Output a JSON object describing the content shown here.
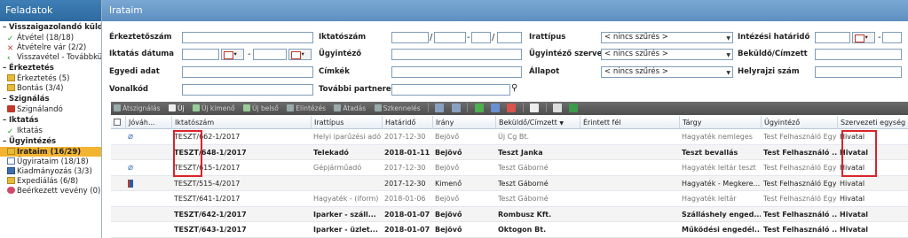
{
  "sidebar": {
    "title": "Feladatok",
    "sections": [
      {
        "label": "Visszaigazolandó küldemé",
        "items": [
          {
            "icon": "check-arrow-icon",
            "label": "Átvétel (18/18)"
          },
          {
            "icon": "cross-arrow-icon",
            "label": "Átvételre vár (2/2)"
          },
          {
            "icon": "reverse-arrow-icon",
            "label": "Visszavétel - Továbbküldé"
          }
        ]
      },
      {
        "label": "Érkeztetés",
        "items": [
          {
            "icon": "folder-icon",
            "label": "Érkeztetés (5)"
          },
          {
            "icon": "folder-icon",
            "label": "Bontás (3/4)"
          }
        ]
      },
      {
        "label": "Szignálás",
        "items": [
          {
            "icon": "stamp-icon",
            "label": "Szignálandó"
          }
        ]
      },
      {
        "label": "Iktatás",
        "items": [
          {
            "icon": "check-icon",
            "label": "Iktatás"
          }
        ]
      },
      {
        "label": "Ügyintézés",
        "items": [
          {
            "icon": "folder-icon",
            "label": "Irataim (16/29)",
            "active": true
          },
          {
            "icon": "document-icon",
            "label": "Ügyirataim (18/18)"
          },
          {
            "icon": "send-icon",
            "label": "Kiadmányozás (3/3)"
          },
          {
            "icon": "folder-icon",
            "label": "Expediálás (6/8)"
          },
          {
            "icon": "inbox-icon",
            "label": "Beérkezett vevény (0)"
          }
        ]
      }
    ]
  },
  "main": {
    "title": "Irataim"
  },
  "filters": {
    "erkeztetoszam": "Érkeztetőszám",
    "iktatoszam": "Iktatószám",
    "irattipus": "Irattípus",
    "intezesi_hatarido": "Intézési határidő",
    "iktatas_datuma": "Iktatás dátuma",
    "ugyintezo": "Ügyintéző",
    "ugyintezo_szervezet": "Ügyintéző szerve...",
    "bekuldo_cimzett": "Beküldő/Címzett",
    "egyedi_adat": "Egyedi adat",
    "cimkek": "Címkék",
    "allapot": "Állapot",
    "helyrajzi_szam": "Helyrajzi szám",
    "vonalkod": "Vonalkód",
    "tovabbi_partnerek": "További partnerek",
    "no_filter": "< nincs szűrés >"
  },
  "toolbar": {
    "atszignalas": "Átszignálás",
    "uj": "Új",
    "uj_kimeno": "Új kimenő",
    "uj_belso": "Új belső",
    "elintezes": "Elintézés",
    "atadas": "Átadás",
    "szkenneles": "Szkennelés"
  },
  "grid": {
    "headers": {
      "jovah": "Jóváh...",
      "iktatoszam": "Iktatószám",
      "irattipus": "Irattípus",
      "hatarido": "Határidő",
      "irany": "Irány",
      "bekuldo": "Beküldő/Címzett",
      "erintett": "Érintett fél",
      "targy": "Tárgy",
      "ugyintezo": "Ügyintéző",
      "szervezeti": "Szervezeti egység"
    },
    "rows": [
      {
        "icon": "attachment-icon",
        "iktato_prefix": "TESZT",
        "iktato_rest": "/662-1/2017",
        "irattipus": "Helyi iparűzési adó",
        "hatarido": "2017-12-30",
        "irany": "Bejövő",
        "bekuldo": "Új Cg Bt.",
        "erintett": "",
        "targy": "Hagyaték nemleges",
        "ugyintezo": "Test Felhasználó Egy",
        "szervezeti": "Hivatal",
        "style": "grey"
      },
      {
        "icon": "",
        "iktato_prefix": "TESZT",
        "iktato_rest": "/648-1/2017",
        "irattipus": "Telekadó",
        "hatarido": "2018-01-11",
        "irany": "Bejövő",
        "bekuldo": "Teszt Janka",
        "erintett": "",
        "targy": "Teszt bevallás",
        "ugyintezo": "Test Felhasználó ...",
        "szervezeti": "Hivatal",
        "style": "bold"
      },
      {
        "icon": "attachment-icon",
        "iktato_prefix": "TESZT",
        "iktato_rest": "/615-1/2017",
        "irattipus": "Gépjárműadó",
        "hatarido": "2017-12-30",
        "irany": "Bejövő",
        "bekuldo": "Teszt Gáborné",
        "erintett": "",
        "targy": "Hagyaték leltár teszt",
        "ugyintezo": "Test Felhasználó Egy",
        "szervezeti": "Hivatal",
        "style": "grey"
      },
      {
        "icon": "book-icon",
        "iktato_prefix": "TESZT",
        "iktato_rest": "/515-4/2017",
        "irattipus": "",
        "hatarido": "2017-12-30",
        "irany": "Kimenő",
        "bekuldo": "Teszt Gáborné",
        "erintett": "",
        "targy": "Hagyaték - Megkere...",
        "ugyintezo": "Test Felhasználó Egy",
        "szervezeti": "Hivatal",
        "style": "normal"
      },
      {
        "icon": "",
        "iktato_prefix": "TESZT",
        "iktato_rest": "/641-1/2017",
        "irattipus": "Hagyaték - (iform)",
        "hatarido": "2018-01-06",
        "irany": "Bejövő",
        "bekuldo": "Teszt Gáborné",
        "erintett": "",
        "targy": "Hagyaték leltár",
        "ugyintezo": "Test Felhasználó Egy",
        "szervezeti": "Hivatal",
        "style": "grey"
      },
      {
        "icon": "",
        "iktato_prefix": "TESZT",
        "iktato_rest": "/642-1/2017",
        "irattipus": "Iparker - száll...",
        "hatarido": "2018-01-07",
        "irany": "Bejövő",
        "bekuldo": "Rombusz Kft.",
        "erintett": "",
        "targy": "Szálláshely enged...",
        "ugyintezo": "Test Felhasználó ...",
        "szervezeti": "Hivatal",
        "style": "bold"
      },
      {
        "icon": "",
        "iktato_prefix": "TESZT",
        "iktato_rest": "/643-1/2017",
        "irattipus": "Iparker - üzlet...",
        "hatarido": "2018-01-07",
        "irany": "Bejövő",
        "bekuldo": "Oktogon Bt.",
        "erintett": "",
        "targy": "Működési engedél...",
        "ugyintezo": "Test Felhasználó ...",
        "szervezeti": "Hivatal",
        "style": "bold"
      }
    ]
  },
  "colors": {
    "sidebar_header": "#2d6aa0",
    "main_header": "#5d8fc0",
    "active_item": "#f2b431",
    "highlight": "#d9242a"
  }
}
